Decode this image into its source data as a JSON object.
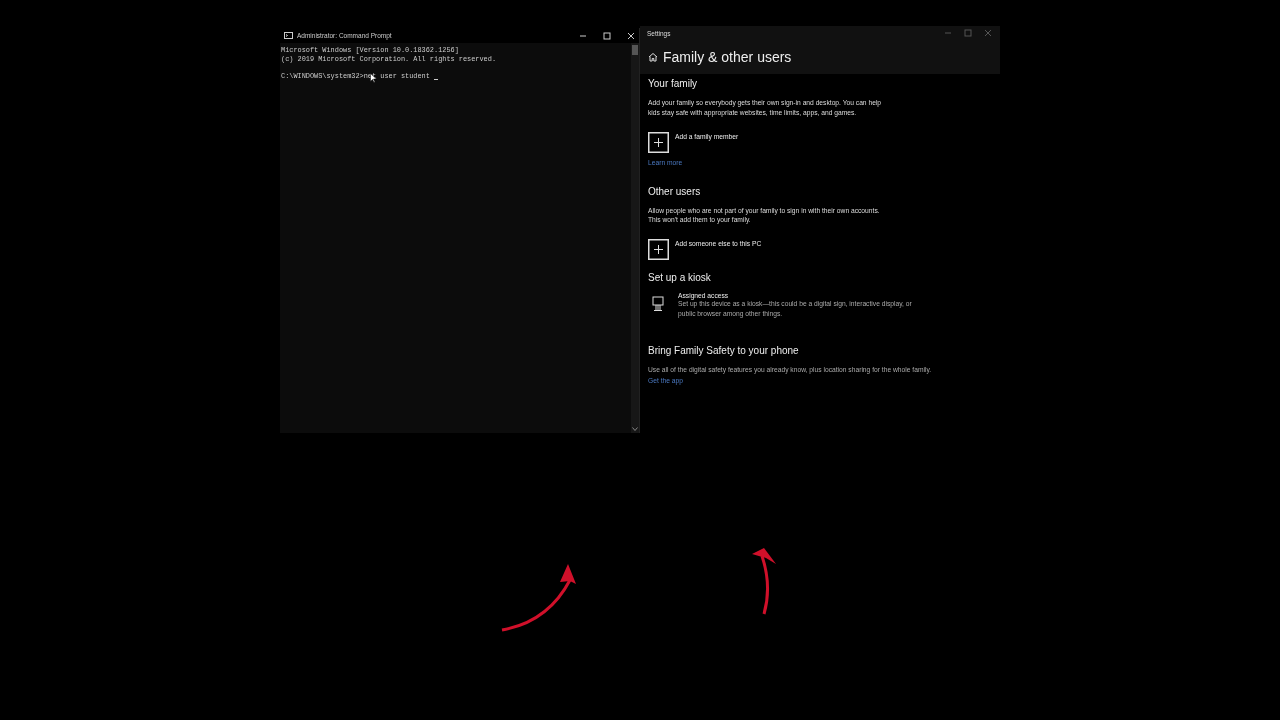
{
  "console": {
    "title": "Administrator: Command Prompt",
    "lines": [
      "Microsoft Windows [Version 10.0.18362.1256]",
      "(c) 2019 Microsoft Corporation. All rights reserved."
    ],
    "prompt": "C:\\WINDOWS\\system32>net user student "
  },
  "settings": {
    "window_title": "Settings",
    "page_title": "Family & other users",
    "sections": [
      {
        "kind": "add",
        "heading": "Your family",
        "text": "Add your family so everybody gets their own sign-in and desktop. You can help kids stay safe with appropriate websites, time limits, apps, and games.",
        "action": "Add a family member",
        "link": "Learn more"
      },
      {
        "kind": "add",
        "heading": "Other users",
        "text": "Allow people who are not part of your family to sign in with their own accounts. This won't add them to your family.",
        "action": "Add someone else to this PC"
      },
      {
        "kind": "kiosk",
        "heading": "Set up a kiosk",
        "action": "Assigned access",
        "text": "Set up this device as a kiosk—this could be a digital sign, interactive display, or public browser among other things."
      },
      {
        "kind": "plain",
        "heading": "Bring Family Safety to your phone",
        "text": "Use all of the digital safety features you already know, plus location sharing for the whole family.",
        "link": "Get the app"
      }
    ]
  }
}
